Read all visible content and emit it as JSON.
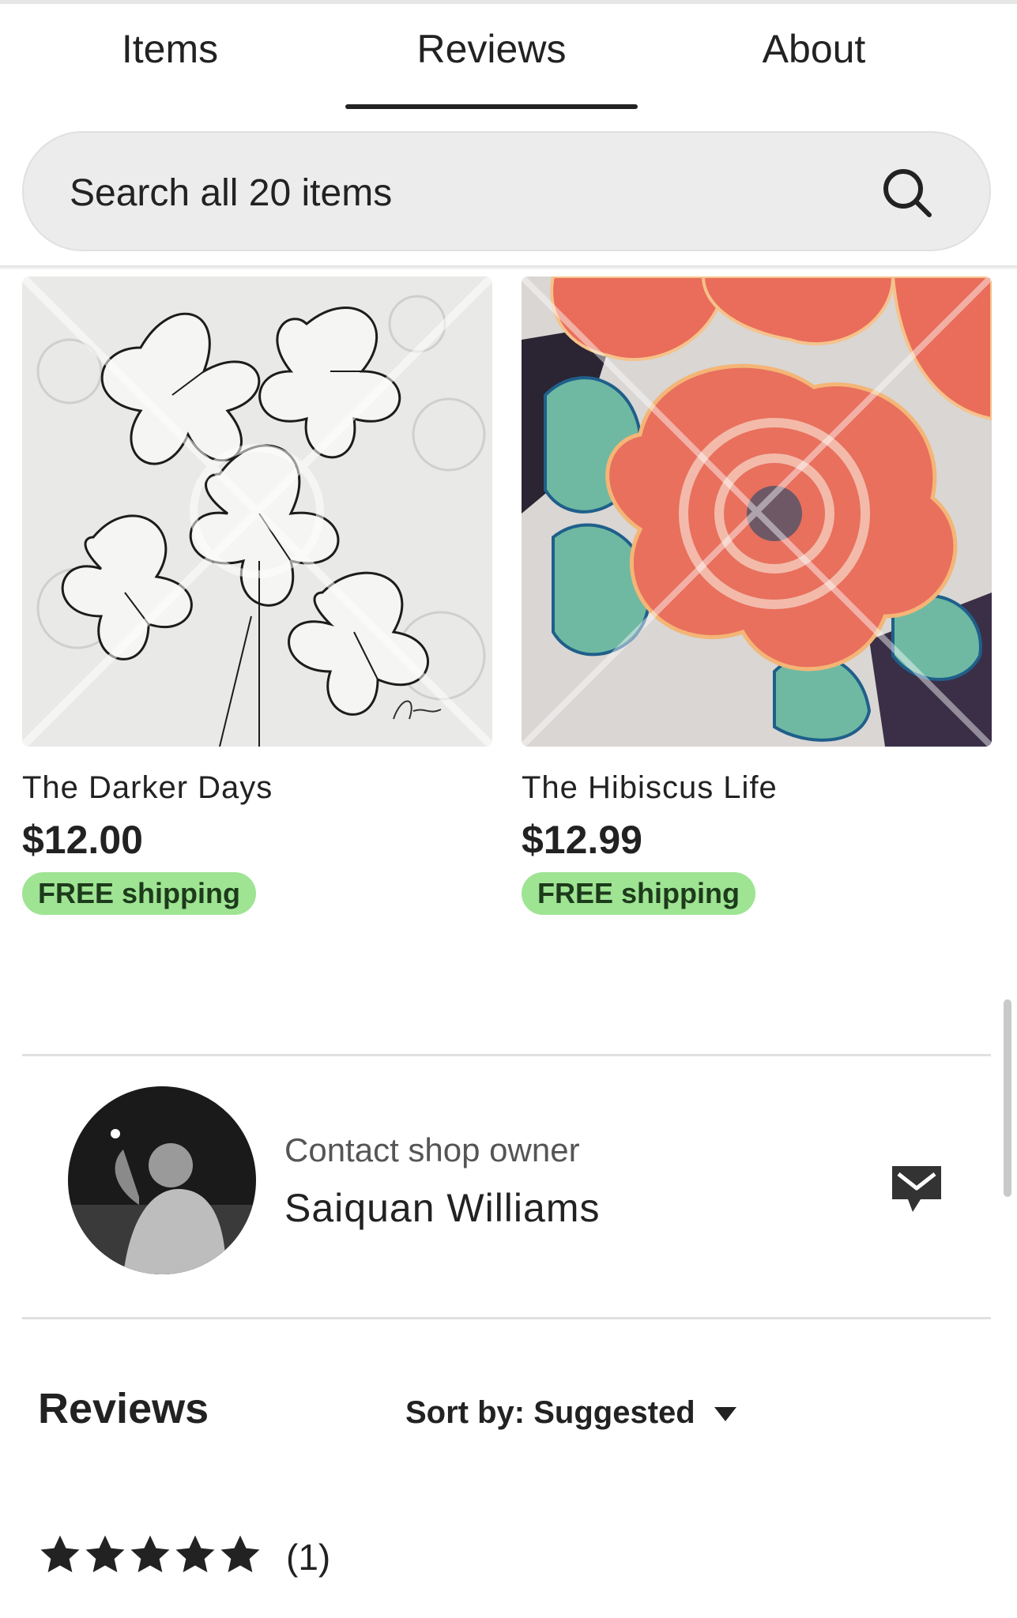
{
  "tabs": [
    {
      "label": "Items"
    },
    {
      "label": "Reviews",
      "active": true
    },
    {
      "label": "About"
    }
  ],
  "search": {
    "placeholder": "Search all 20 items"
  },
  "products": [
    {
      "title": "The Darker Days",
      "price": "$12.00",
      "badge": "FREE shipping",
      "image": "pen-and-ink-lily-drawing"
    },
    {
      "title": "The Hibiscus Life",
      "price": "$12.99",
      "badge": "FREE shipping",
      "image": "hibiscus-marker-painting"
    }
  ],
  "contact": {
    "label": "Contact shop owner",
    "name": "Saiquan Williams",
    "icon": "envelope-message-icon"
  },
  "reviews": {
    "heading": "Reviews",
    "sort_label": "Sort by: Suggested",
    "rating": 5,
    "count_text": "(1)"
  },
  "colors": {
    "badge_bg": "#9ee493",
    "text": "#222222",
    "search_bg": "#ececec"
  }
}
